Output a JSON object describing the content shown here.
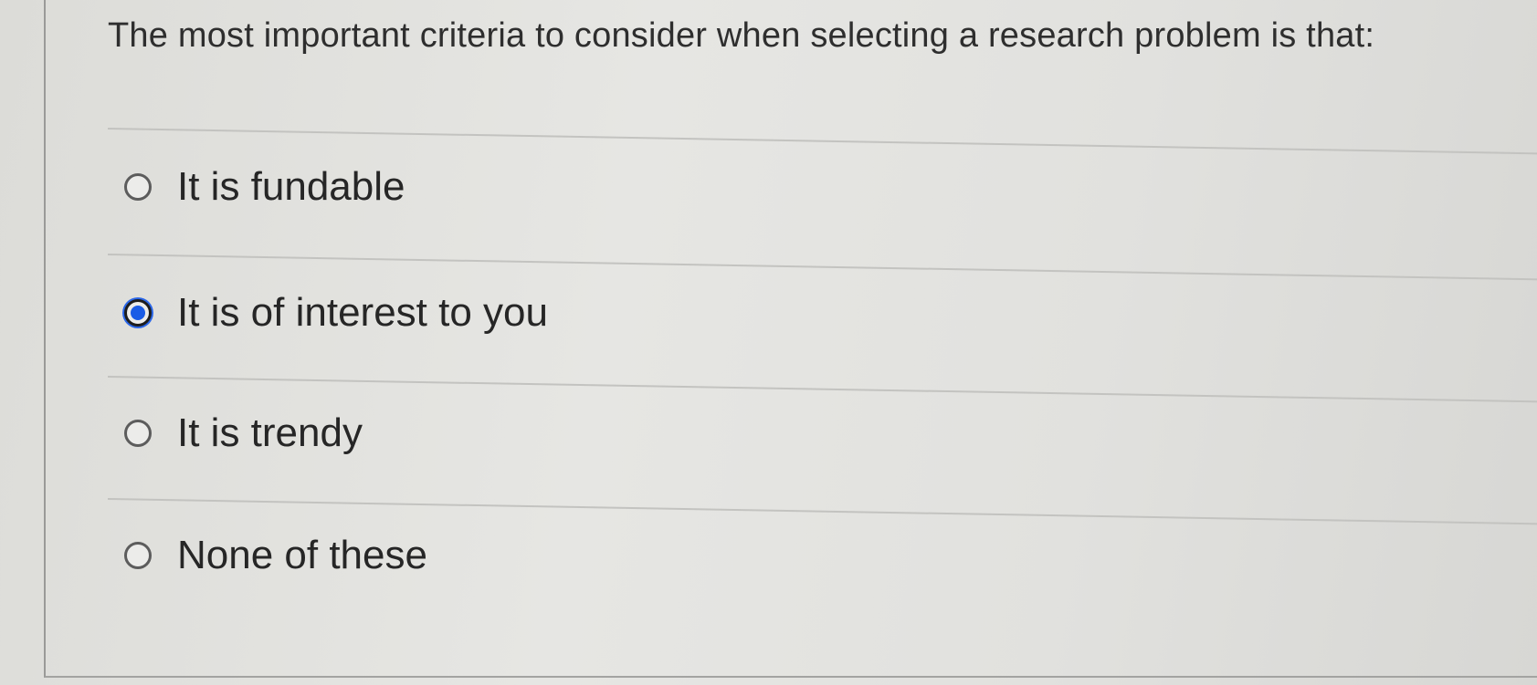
{
  "question": {
    "text": "The most important criteria to consider when selecting a research problem is that:"
  },
  "options": [
    {
      "label": "It is fundable",
      "selected": false
    },
    {
      "label": "It is of interest to you",
      "selected": true
    },
    {
      "label": "It is trendy",
      "selected": false
    },
    {
      "label": "None of these",
      "selected": false
    }
  ],
  "colors": {
    "selected_radio": "#1a5ce6",
    "text": "#262626"
  }
}
